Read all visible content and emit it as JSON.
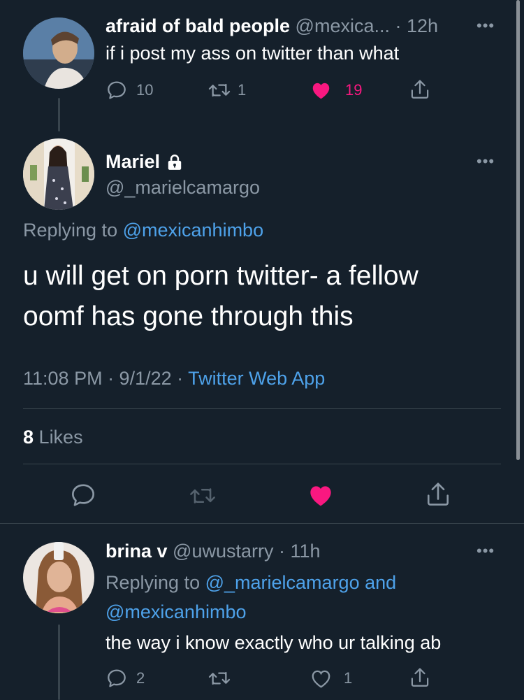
{
  "tweet1": {
    "display_name": "afraid of bald people",
    "handle": "@mexica...",
    "time": "· 12h",
    "text": "if i post my ass on twitter than what",
    "replies": "10",
    "retweets": "1",
    "likes": "19",
    "liked": true
  },
  "main_tweet": {
    "display_name": "Mariel",
    "handle": "@_marielcamargo",
    "protected": true,
    "replying_prefix": "Replying to",
    "replying_to": "@mexicanhimbo",
    "text_line1": "u will get on porn twitter- a fellow",
    "text_line2": "oomf has gone through this",
    "timestamp": "11:08 PM · 9/1/22 ·",
    "source": "Twitter Web App",
    "likes_count": "8",
    "likes_label": "Likes",
    "liked": true
  },
  "tweet3": {
    "display_name": "brina v",
    "handle": "@uwustarry",
    "time": "· 11h",
    "replying_prefix": "Replying to",
    "replying_to_1": "@_marielcamargo",
    "replying_and": "and",
    "replying_to_2": "@mexicanhimbo",
    "text": "the way i know exactly who ur talking ab",
    "replies": "2",
    "retweets": "",
    "likes": "1",
    "liked": false
  },
  "icons": {
    "reply": "reply-icon",
    "retweet": "retweet-icon",
    "like": "heart-icon",
    "share": "share-icon",
    "more": "more-icon",
    "lock": "lock-icon"
  },
  "colors": {
    "background": "#15202b",
    "muted": "#8b98a5",
    "link": "#4ea2ea",
    "like": "#f91880",
    "divider": "#38444d"
  }
}
